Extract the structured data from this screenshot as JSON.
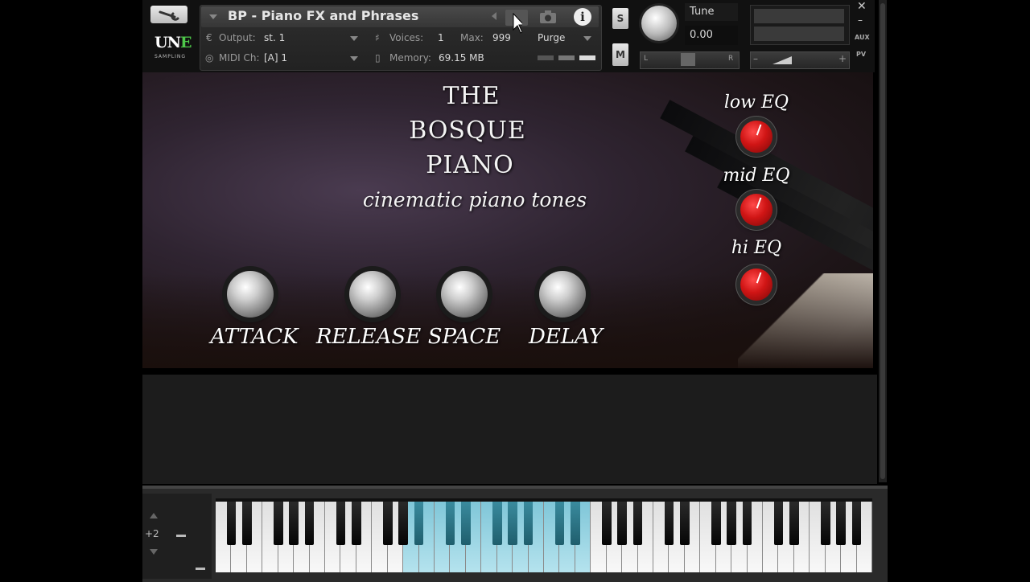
{
  "header": {
    "instrument_name": "BP - Piano FX and Phrases",
    "output_label": "Output:",
    "output_value": "st. 1",
    "voices_label": "Voices:",
    "voices_value": "1",
    "max_label": "Max:",
    "max_value": "999",
    "purge_label": "Purge",
    "midi_label": "MIDI Ch:",
    "midi_value": "[A]  1",
    "memory_label": "Memory:",
    "memory_value": "69.15 MB",
    "solo_label": "S",
    "mute_label": "M",
    "tune_label": "Tune",
    "tune_value": "0.00",
    "pan_left": "L",
    "pan_right": "R",
    "aux_label": "AUX",
    "pv_label": "PV",
    "close_label": "✕",
    "minimize_label": "–",
    "vol_minus": "–",
    "vol_plus": "+",
    "info_label": "i"
  },
  "logo": {
    "text_main": "UN",
    "text_accent": "E",
    "text_sub": "SAMPLING"
  },
  "title": {
    "line1": "THE",
    "line2": "BOSQUE",
    "line3": "PIANO",
    "subtitle": "cinematic piano tones"
  },
  "knobs": [
    {
      "label": "ATTACK"
    },
    {
      "label": "RELEASE"
    },
    {
      "label": "SPACE"
    },
    {
      "label": "DELAY"
    }
  ],
  "eq": [
    {
      "label": "low EQ"
    },
    {
      "label": "mid EQ"
    },
    {
      "label": "hi EQ"
    }
  ],
  "keyboard": {
    "octave_shift": "+2",
    "highlight_color": "#8fd1e0"
  }
}
